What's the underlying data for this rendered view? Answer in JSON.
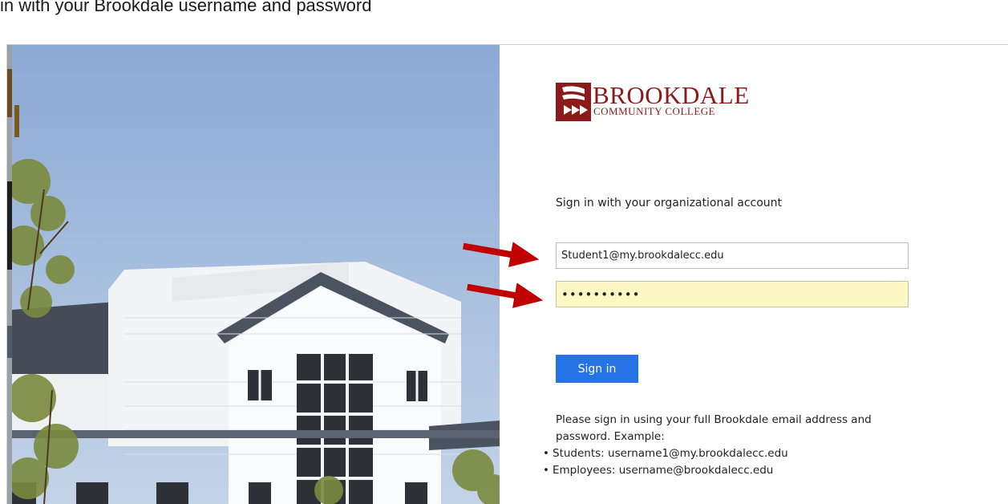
{
  "document": {
    "heading": "in with your Brookdale username and password"
  },
  "logo": {
    "main_text": "BROOKDALE",
    "sub_text": "COMMUNITY COLLEGE",
    "brand_color": "#8c1a1a"
  },
  "form": {
    "prompt": "Sign in with your organizational account",
    "username_value": "Student1@my.brookdalecc.edu",
    "password_value": "••••••••••",
    "signin_label": "Sign in",
    "button_color": "#2673e6",
    "password_field_color": "#fdf7c6"
  },
  "help": {
    "text": "Please sign in using your full Brookdale email address and password. Example:",
    "items": [
      "Students: username1@my.brookdalecc.edu",
      "Employees: username@brookdalecc.edu"
    ]
  },
  "annotations": {
    "arrow_color": "#c00000",
    "arrows": [
      "username-field",
      "password-field"
    ]
  }
}
